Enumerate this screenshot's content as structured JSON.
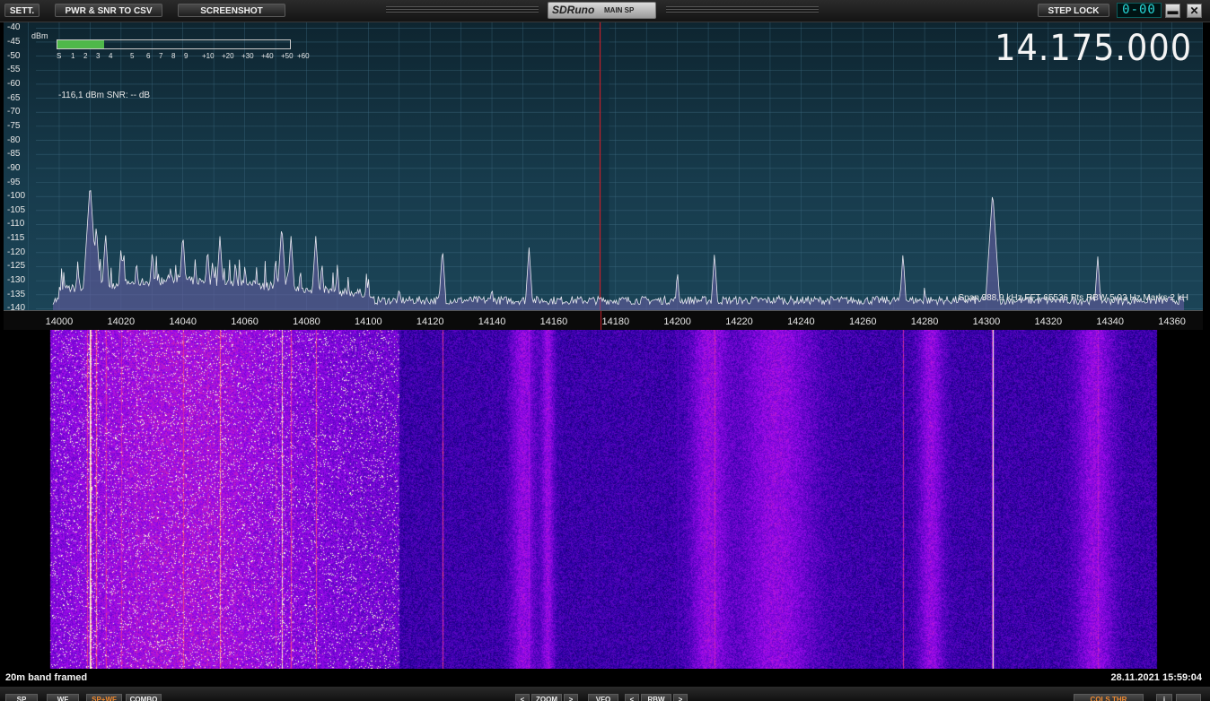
{
  "toolbar": {
    "sett_label": "SETT.",
    "csv_label": "PWR & SNR TO CSV",
    "screenshot_label": "SCREENSHOT",
    "logo_brand": "SDRuno",
    "logo_window": "MAIN SP",
    "step_lock_label": "STEP LOCK",
    "step_display": "0-00",
    "minimize_symbol": "▬",
    "close_symbol": "✕"
  },
  "spectrum": {
    "unit_label": "dBm",
    "y_ticks": [
      "-40",
      "-45",
      "-50",
      "-55",
      "-60",
      "-65",
      "-70",
      "-75",
      "-80",
      "-85",
      "-90",
      "-95",
      "-100",
      "-105",
      "-110",
      "-115",
      "-120",
      "-125",
      "-130",
      "-135",
      "-140"
    ],
    "smeter_scale": [
      "S",
      "1",
      "2",
      "3",
      "4",
      "5",
      "6",
      "7",
      "8",
      "9",
      "+10",
      "+20",
      "+30",
      "+40",
      "+50",
      "+60"
    ],
    "smeter_level_fraction": 0.2,
    "signal_readout": "-116,1 dBm   SNR: -- dB",
    "frequency_display": "14.175.000",
    "fft_info": "Span 388,9 kHz   FFT 65536 Pts   RBW 5,93 Hz   Marks 2 kH",
    "x_ticks": [
      "14000",
      "14020",
      "14040",
      "14060",
      "14080",
      "14100",
      "14120",
      "14140",
      "14160",
      "14180",
      "14200",
      "14220",
      "14240",
      "14260",
      "14280",
      "14300",
      "14320",
      "14340",
      "14360"
    ],
    "span_start_khz": 13982,
    "span_end_khz": 14370,
    "tuned_khz": 14175,
    "noise_floor_dbm": -137,
    "peaks": [
      {
        "khz": 14003,
        "dbm": -130
      },
      {
        "khz": 14006,
        "dbm": -123
      },
      {
        "khz": 14009,
        "dbm": -118
      },
      {
        "khz": 14010,
        "dbm": -95
      },
      {
        "khz": 14012,
        "dbm": -110
      },
      {
        "khz": 14015,
        "dbm": -113
      },
      {
        "khz": 14020,
        "dbm": -118
      },
      {
        "khz": 14025,
        "dbm": -122
      },
      {
        "khz": 14030,
        "dbm": -120
      },
      {
        "khz": 14036,
        "dbm": -125
      },
      {
        "khz": 14040,
        "dbm": -113
      },
      {
        "khz": 14044,
        "dbm": -122
      },
      {
        "khz": 14048,
        "dbm": -118
      },
      {
        "khz": 14052,
        "dbm": -114
      },
      {
        "khz": 14057,
        "dbm": -122
      },
      {
        "khz": 14060,
        "dbm": -125
      },
      {
        "khz": 14070,
        "dbm": -121
      },
      {
        "khz": 14072,
        "dbm": -110
      },
      {
        "khz": 14075,
        "dbm": -114
      },
      {
        "khz": 14078,
        "dbm": -125
      },
      {
        "khz": 14083,
        "dbm": -114
      },
      {
        "khz": 14085,
        "dbm": -123
      },
      {
        "khz": 14090,
        "dbm": -124
      },
      {
        "khz": 14100,
        "dbm": -128
      },
      {
        "khz": 14110,
        "dbm": -131
      },
      {
        "khz": 14124,
        "dbm": -118
      },
      {
        "khz": 14140,
        "dbm": -131
      },
      {
        "khz": 14152,
        "dbm": -118
      },
      {
        "khz": 14200,
        "dbm": -126
      },
      {
        "khz": 14212,
        "dbm": -120
      },
      {
        "khz": 14233,
        "dbm": -133
      },
      {
        "khz": 14273,
        "dbm": -120
      },
      {
        "khz": 14280,
        "dbm": -131
      },
      {
        "khz": 14302,
        "dbm": -98
      },
      {
        "khz": 14336,
        "dbm": -121
      }
    ]
  },
  "status": {
    "left_text": "20m band framed",
    "datetime": "28.11.2021 15:59:04"
  },
  "bottombar": {
    "sp_label": "SP",
    "wf_label": "WF",
    "spwf_label": "SP+WF",
    "combo_label": "COMBO",
    "zoom_prev": "<",
    "zoom_label": "ZOOM",
    "zoom_next": ">",
    "vfo_label": "VFO",
    "rbw_prev": "<",
    "rbw_label": "RBW",
    "rbw_next": ">",
    "colour_label": "COLS THR",
    "info_label": "i"
  },
  "colors": {
    "spectrum_bg": "#173b4c",
    "trace": "#e8e8f0",
    "fill": "#6b5ea8",
    "smeter": "#4fb84a",
    "tuned_marker": "#c0202a"
  }
}
